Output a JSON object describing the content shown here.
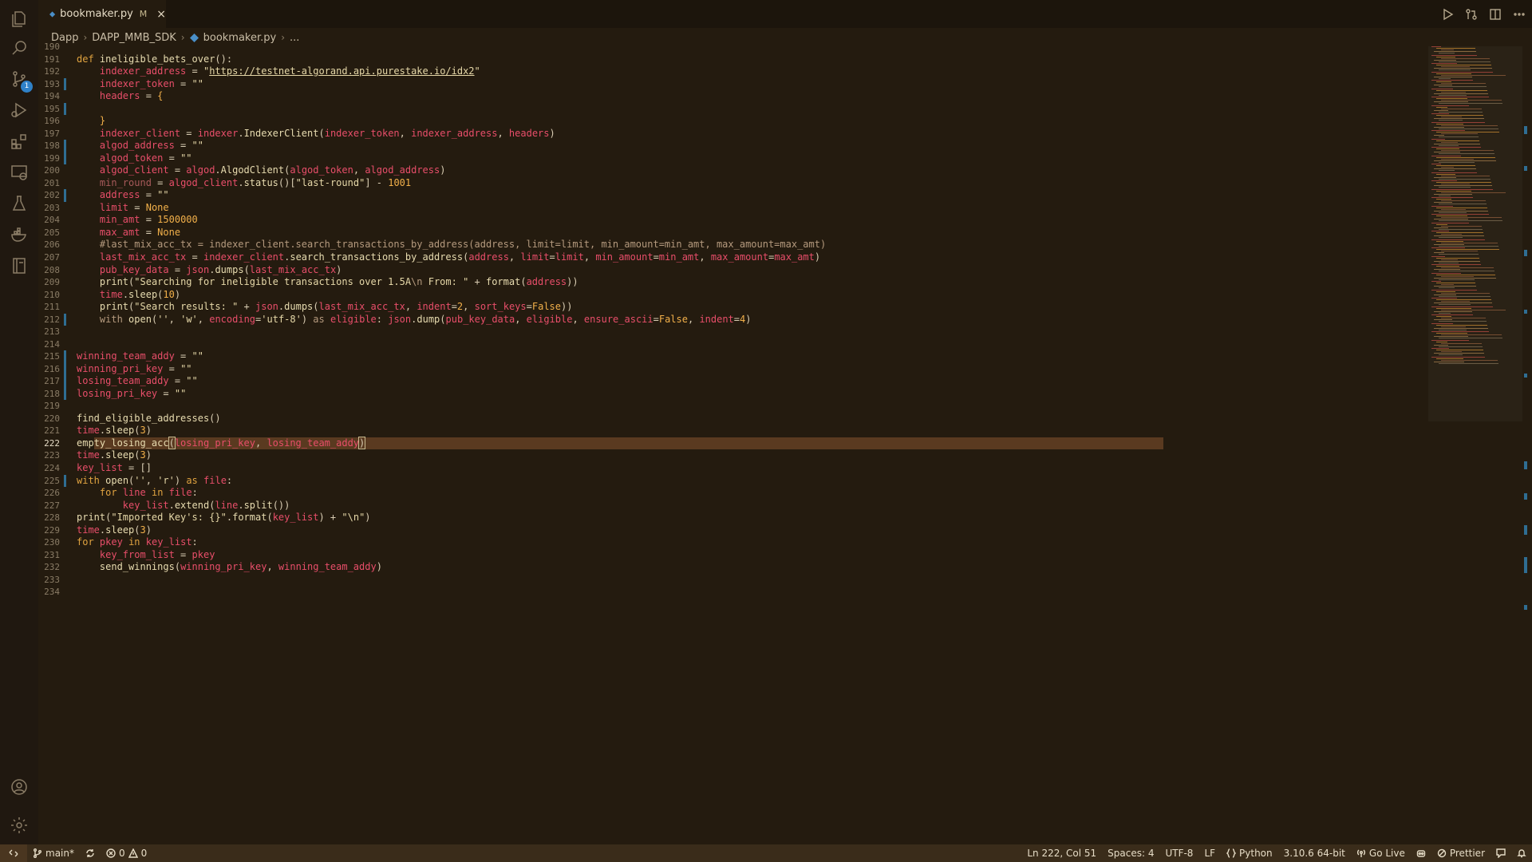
{
  "tab": {
    "filename": "bookmaker.py",
    "modified": "M",
    "close": "×"
  },
  "breadcrumb": {
    "items": [
      "Dapp",
      "DAPP_MMB_SDK",
      "bookmaker.py",
      "..."
    ]
  },
  "activity": {
    "scm_badge": "1"
  },
  "editor": {
    "current_line": 222,
    "lines": [
      {
        "n": "190",
        "html": ""
      },
      {
        "n": "191",
        "html": "<span class='kw'>def</span> <span class='fn'>ineligible_bets_over</span><span class='punc'>():</span>"
      },
      {
        "n": "192",
        "html": "    <span class='var'>indexer_address</span> = <span class='str'>\"<span class='url'>https://testnet-algorand.api.purestake.io/idx2</span>\"</span>"
      },
      {
        "n": "193",
        "html": "    <span class='var'>indexer_token</span> = <span class='str'>\"\"</span>"
      },
      {
        "n": "194",
        "html": "    <span class='var'>headers</span> = <span class='num'>{</span>"
      },
      {
        "n": "195",
        "html": ""
      },
      {
        "n": "196",
        "html": "    <span class='num'>}</span>"
      },
      {
        "n": "197",
        "html": "    <span class='var'>indexer_client</span> = <span class='var'>indexer</span>.<span class='fn'>IndexerClient</span>(<span class='var'>indexer_token</span>, <span class='var'>indexer_address</span>, <span class='var'>headers</span>)"
      },
      {
        "n": "198",
        "html": "    <span class='var'>algod_address</span> = <span class='str'>\"\"</span>"
      },
      {
        "n": "199",
        "html": "    <span class='var'>algod_token</span> = <span class='str'>\"\"</span>"
      },
      {
        "n": "200",
        "html": "    <span class='var'>algod_client</span> = <span class='var'>algod</span>.<span class='fn'>AlgodClient</span>(<span class='var'>algod_token</span>, <span class='var'>algod_address</span>)"
      },
      {
        "n": "201",
        "html": "    <span class='dim'>min_round</span> = <span class='var'>algod_client</span>.<span class='fn'>status</span>()[<span class='str'>\"last-round\"</span>] - <span class='num'>1001</span>"
      },
      {
        "n": "202",
        "html": "    <span class='var'>address</span> = <span class='str'>\"\"</span>"
      },
      {
        "n": "203",
        "html": "    <span class='var'>limit</span> = <span class='num'>None</span>"
      },
      {
        "n": "204",
        "html": "    <span class='var'>min_amt</span> = <span class='num'>1500000</span>"
      },
      {
        "n": "205",
        "html": "    <span class='var'>max_amt</span> = <span class='num'>None</span>"
      },
      {
        "n": "206",
        "html": "    <span class='cm'>#last_mix_acc_tx = indexer_client.search_transactions_by_address(address, limit=limit, min_amount=min_amt, max_amount=max_amt)</span>"
      },
      {
        "n": "207",
        "html": "    <span class='var'>last_mix_acc_tx</span> = <span class='var'>indexer_client</span>.<span class='fn'>search_transactions_by_address</span>(<span class='var'>address</span>, <span class='var'>limit</span>=<span class='var'>limit</span>, <span class='var'>min_amount</span>=<span class='var'>min_amt</span>, <span class='var'>max_amount</span>=<span class='var'>max_amt</span>)"
      },
      {
        "n": "208",
        "html": "    <span class='var'>pub_key_data</span> = <span class='var'>json</span>.<span class='fn'>dumps</span>(<span class='var'>last_mix_acc_tx</span>)"
      },
      {
        "n": "209",
        "html": "    <span class='fn'>print</span>(<span class='str'>\"Searching for ineligible transactions over 1.5A</span><span class='cm'>\\n</span><span class='str'> From: \"</span> + <span class='fn'>format</span>(<span class='var'>address</span>))"
      },
      {
        "n": "210",
        "html": "    <span class='var'>time</span>.<span class='fn'>sleep</span>(<span class='num'>10</span>)"
      },
      {
        "n": "211",
        "html": "    <span class='fn'>print</span>(<span class='str'>\"Search results: \"</span> + <span class='var'>json</span>.<span class='fn'>dumps</span>(<span class='var'>last_mix_acc_tx</span>, <span class='var'>indent</span>=<span class='num'>2</span>, <span class='var'>sort_keys</span>=<span class='num'>False</span>))"
      },
      {
        "n": "212",
        "html": "    <span class='cm'>with</span> <span class='fn'>open</span>(<span class='str'>''</span>, <span class='str'>'w'</span>, <span class='var'>encoding</span>=<span class='str'>'utf-8'</span>) <span class='cm'>as</span> <span class='var'>eligible</span>: <span class='var'>json</span>.<span class='fn'>dump</span>(<span class='var'>pub_key_data</span>, <span class='var'>eligible</span>, <span class='var'>ensure_ascii</span>=<span class='num'>False</span>, <span class='var'>indent</span>=<span class='num'>4</span>)"
      },
      {
        "n": "213",
        "html": ""
      },
      {
        "n": "214",
        "html": ""
      },
      {
        "n": "215",
        "html": "<span class='var'>winning_team_addy</span> = <span class='str'>\"\"</span>"
      },
      {
        "n": "216",
        "html": "<span class='var'>winning_pri_key</span> = <span class='str'>\"\"</span>"
      },
      {
        "n": "217",
        "html": "<span class='var'>losing_team_addy</span> = <span class='str'>\"\"</span>"
      },
      {
        "n": "218",
        "html": "<span class='var'>losing_pri_key</span> = <span class='str'>\"\"</span>"
      },
      {
        "n": "219",
        "html": ""
      },
      {
        "n": "220",
        "html": "<span class='fn'>find_eligible_addresses</span>()"
      },
      {
        "n": "221",
        "html": "<span class='var'>time</span>.<span class='fn'>sleep</span>(<span class='num'>3</span>)"
      },
      {
        "n": "222",
        "html": "<span class='fn'>empty_losing_acc</span><span class='brk'>(</span><span class='var'>losing_pri_key</span>, <span class='var'>losing_team_addy</span><span class='brk'>)</span>"
      },
      {
        "n": "223",
        "html": "<span class='var'>time</span>.<span class='fn'>sleep</span>(<span class='num'>3</span>)"
      },
      {
        "n": "224",
        "html": "<span class='var'>key_list</span> = []"
      },
      {
        "n": "225",
        "html": "<span class='kw'>with</span> <span class='fn'>open</span>(<span class='str'>''</span>, <span class='str'>'r'</span>) <span class='kw'>as</span> <span class='var'>file</span>:"
      },
      {
        "n": "226",
        "html": "    <span class='kw'>for</span> <span class='var'>line</span> <span class='kw'>in</span> <span class='var'>file</span>:"
      },
      {
        "n": "227",
        "html": "        <span class='var'>key_list</span>.<span class='fn'>extend</span>(<span class='var'>line</span>.<span class='fn'>split</span>())"
      },
      {
        "n": "228",
        "html": "<span class='fn'>print</span>(<span class='str'>\"Imported Key's: {}\"</span>.<span class='fn'>format</span>(<span class='var'>key_list</span>) + <span class='str'>\"\\n\"</span>)"
      },
      {
        "n": "229",
        "html": "<span class='var'>time</span>.<span class='fn'>sleep</span>(<span class='num'>3</span>)"
      },
      {
        "n": "230",
        "html": "<span class='kw'>for</span> <span class='var'>pkey</span> <span class='kw'>in</span> <span class='var'>key_list</span>:"
      },
      {
        "n": "231",
        "html": "    <span class='var'>key_from_list</span> = <span class='var'>pkey</span>"
      },
      {
        "n": "232",
        "html": "    <span class='fn'>send_winnings</span>(<span class='var'>winning_pri_key</span>, <span class='var'>winning_team_addy</span>)"
      },
      {
        "n": "233",
        "html": ""
      },
      {
        "n": "234",
        "html": ""
      }
    ],
    "modified_lines": [
      "193",
      "195",
      "198",
      "199",
      "202",
      "212",
      "215",
      "216",
      "217",
      "218",
      "225"
    ]
  },
  "status": {
    "branch": "main*",
    "errors": "0",
    "warnings": "0",
    "position": "Ln 222, Col 51",
    "spaces": "Spaces: 4",
    "encoding": "UTF-8",
    "eol": "LF",
    "language": "Python",
    "interpreter": "3.10.6 64-bit",
    "golive": "Go Live",
    "prettier": "Prettier"
  },
  "colors": {
    "background": "#241b0f",
    "status_bar": "#3a2c1a",
    "accent": "#2f81c8",
    "current_line": "#5a3a20"
  }
}
